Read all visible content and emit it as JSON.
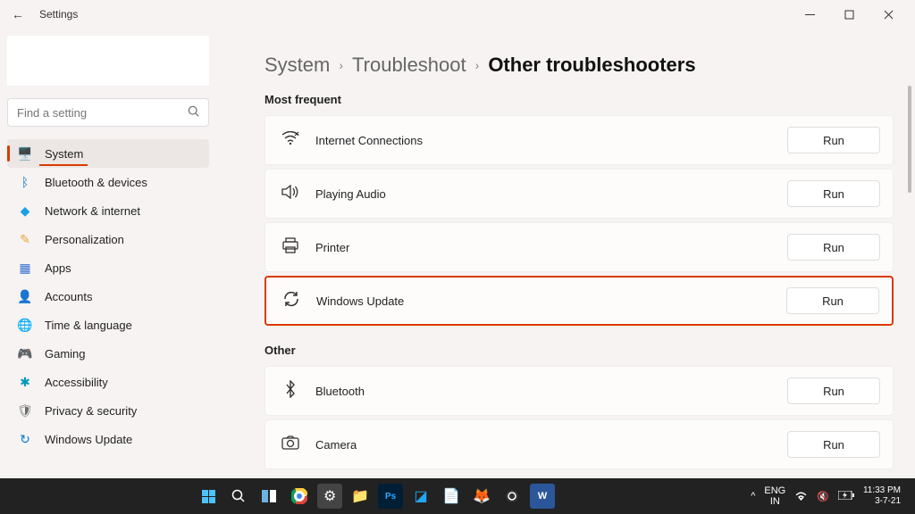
{
  "window": {
    "title": "Settings"
  },
  "search": {
    "placeholder": "Find a setting"
  },
  "nav": [
    {
      "label": "System",
      "icon": "🖥️",
      "color": "#5b5b5b",
      "active": true
    },
    {
      "label": "Bluetooth & devices",
      "icon": "ᛒ",
      "color": "#0078d4"
    },
    {
      "label": "Network & internet",
      "icon": "◆",
      "color": "#1ba1e2"
    },
    {
      "label": "Personalization",
      "icon": "✎",
      "color": "#e8a33d"
    },
    {
      "label": "Apps",
      "icon": "▦",
      "color": "#3971d1"
    },
    {
      "label": "Accounts",
      "icon": "👤",
      "color": "#f0a30a"
    },
    {
      "label": "Time & language",
      "icon": "🌐",
      "color": "#3971d1"
    },
    {
      "label": "Gaming",
      "icon": "🎮",
      "color": "#777"
    },
    {
      "label": "Accessibility",
      "icon": "✱",
      "color": "#0099bc"
    },
    {
      "label": "Privacy & security",
      "icon": "🛡",
      "color": "#6b6b6b"
    },
    {
      "label": "Windows Update",
      "icon": "↻",
      "color": "#0078d4"
    }
  ],
  "breadcrumb": {
    "a": "System",
    "b": "Troubleshoot",
    "c": "Other troubleshooters"
  },
  "sections": {
    "most_frequent": {
      "title": "Most frequent",
      "items": [
        {
          "label": "Internet Connections",
          "icon": "wifi",
          "button": "Run",
          "highlight": false
        },
        {
          "label": "Playing Audio",
          "icon": "speaker",
          "button": "Run",
          "highlight": false
        },
        {
          "label": "Printer",
          "icon": "printer",
          "button": "Run",
          "highlight": false
        },
        {
          "label": "Windows Update",
          "icon": "refresh",
          "button": "Run",
          "highlight": true
        }
      ]
    },
    "other": {
      "title": "Other",
      "items": [
        {
          "label": "Bluetooth",
          "icon": "bt",
          "button": "Run"
        },
        {
          "label": "Camera",
          "icon": "camera",
          "button": "Run"
        }
      ]
    }
  },
  "taskbar": {
    "lang": "ENG",
    "region": "IN",
    "time": "11:33 PM",
    "date": "3-7-21"
  }
}
